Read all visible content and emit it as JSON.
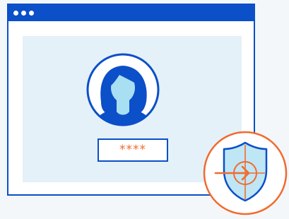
{
  "window": {
    "titlebar_dots": 3
  },
  "password_field": {
    "value": "****"
  },
  "icons": {
    "avatar": "user-avatar-icon",
    "badge": "shield-login-icon"
  },
  "colors": {
    "primary_blue": "#0b4fc9",
    "accent_orange": "#f26a2e",
    "content_bg": "#e4f1f8",
    "skin": "#a8dff2",
    "shield_fill": "#bfe6f5"
  }
}
